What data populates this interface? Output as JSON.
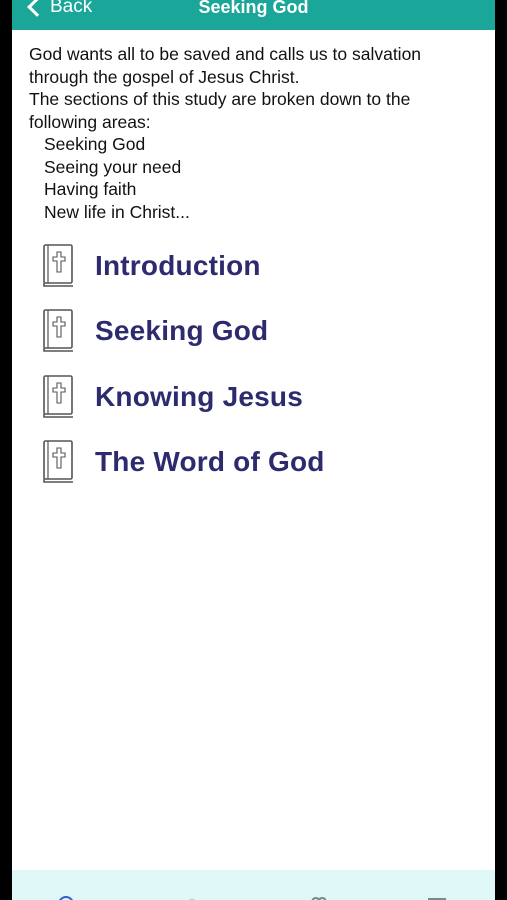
{
  "navbar": {
    "back_label": "Back",
    "title": "Seeking God",
    "color": "#1aa79a"
  },
  "intro": {
    "line1": "God wants all to be saved and calls us to salvation through the gospel of Jesus Christ.",
    "line2": "The sections of this study are broken down to the following areas:",
    "areas": [
      "Seeking God",
      "Seeing your need",
      "Having faith",
      "New life in Christ..."
    ]
  },
  "menu": {
    "items": [
      {
        "label": "Introduction",
        "icon": "bible-icon"
      },
      {
        "label": "Seeking God",
        "icon": "bible-icon"
      },
      {
        "label": "Knowing Jesus",
        "icon": "bible-icon"
      },
      {
        "label": "The Word of God",
        "icon": "bible-icon"
      }
    ],
    "label_color": "#2d2b6e"
  },
  "tabbar": {
    "background": "#dff7f6",
    "icons": [
      "home-icon",
      "search-icon",
      "favorites-icon",
      "library-icon"
    ]
  }
}
